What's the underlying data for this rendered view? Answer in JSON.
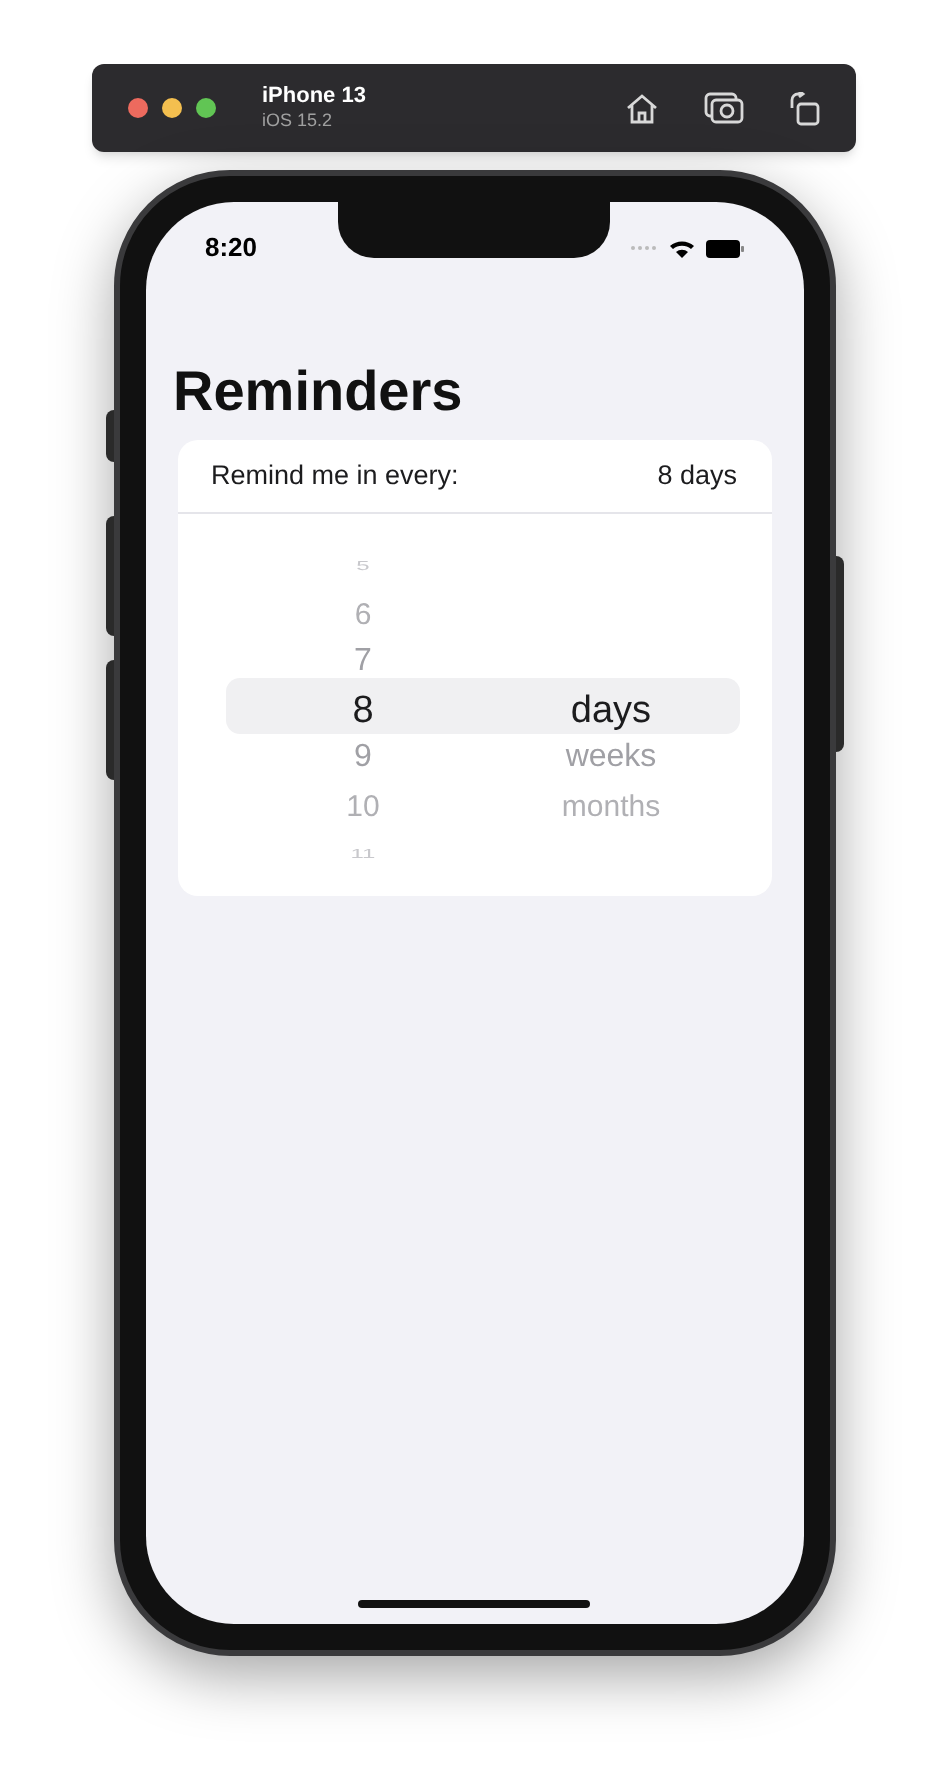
{
  "simulator": {
    "device": "iPhone 13",
    "os": "iOS 15.2"
  },
  "status_bar": {
    "time": "8:20"
  },
  "title": "Reminders",
  "setting": {
    "label": "Remind me in every:",
    "value": "8 days"
  },
  "picker": {
    "numbers": [
      {
        "label": "5",
        "selected": false
      },
      {
        "label": "6",
        "selected": false
      },
      {
        "label": "7",
        "selected": false
      },
      {
        "label": "8",
        "selected": true
      },
      {
        "label": "9",
        "selected": false
      },
      {
        "label": "10",
        "selected": false
      },
      {
        "label": "11",
        "selected": false
      }
    ],
    "units": [
      {
        "label": "days",
        "selected": true
      },
      {
        "label": "weeks",
        "selected": false
      },
      {
        "label": "months",
        "selected": false
      }
    ]
  }
}
